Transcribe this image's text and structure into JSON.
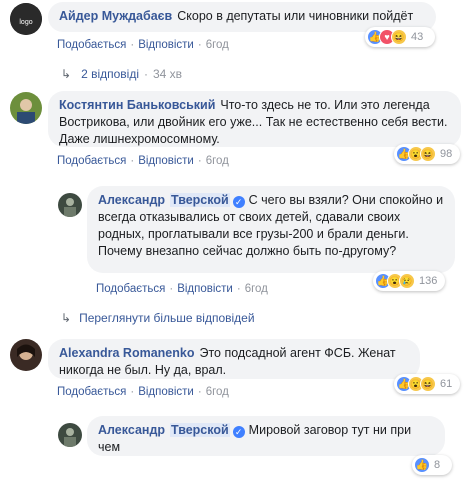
{
  "labels": {
    "like": "Подобається",
    "reply": "Відповісти",
    "sep": "·"
  },
  "comments": [
    {
      "author": "Айдер Муждабаєв",
      "text": "Скоро в депутаты или чиновники пойдёт",
      "time": "6год",
      "count": "43",
      "reply_toggle": {
        "label": "2 відповіді",
        "time": "34 хв"
      }
    },
    {
      "author": "Костянтин Баньковський",
      "text": "Что-то здесь не то. Или это легенда Вострикова, или двойник его уже... Так не естественно себя вести. Даже лишнехромосомному.",
      "time": "6год",
      "count": "98"
    },
    {
      "author_first": "Александр",
      "author_last": "Тверской",
      "text": "С чего вы взяли? Они спокойно и всегда отказывались от своих детей, сдавали своих родных, проглатывали все грузы-200 и брали деньги. Почему внезапно сейчас должно быть по-другому?",
      "time": "6год",
      "count": "136",
      "like_label": "Подобається"
    },
    {
      "more_replies": "Переглянути більше відповідей"
    },
    {
      "author": "Alexandra Romanenko",
      "text": "Это подсадной агент ФСБ. Женат никогда не был. Ну да, врал.",
      "time": "6год",
      "count": "61"
    },
    {
      "author_first": "Александр",
      "author_last": "Тверской",
      "text": "Мировой заговор тут ни при чем",
      "count": "8"
    }
  ]
}
